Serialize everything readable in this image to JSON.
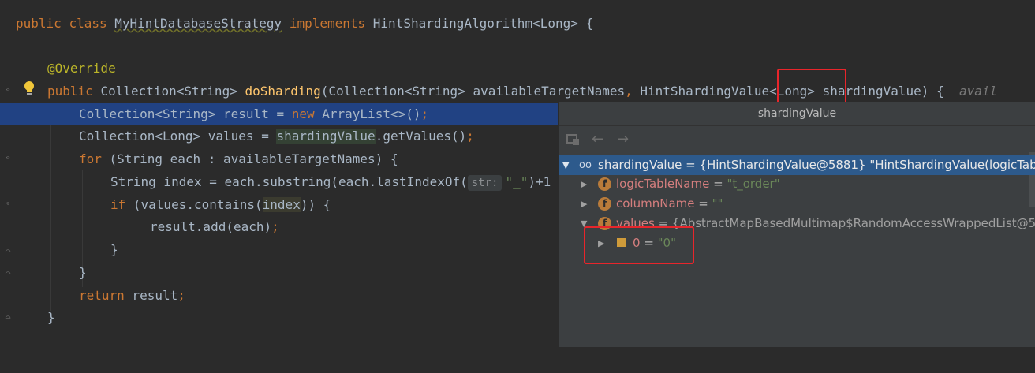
{
  "code": {
    "class_line": {
      "kw1": "public",
      "kw2": "class",
      "class_name": "MyHintDatabaseStrategy",
      "kw3": "implements",
      "rest": "HintShardingAlgorithm<Long> {"
    },
    "override": "@Override",
    "method_line": {
      "kw": "public",
      "ret": "Collection<String>",
      "name": "doSharding",
      "params1": "(Collection<String> availableTargetNames",
      "comma": ",",
      "params2": " HintShardingValue<Long> shardingValue) {",
      "hint": "avail"
    },
    "line_result": {
      "a": "Collection<String> result = ",
      "new": "new",
      "b": " ArrayList<>()",
      "semi": ";"
    },
    "line_values": {
      "a": "Collection<Long> values = ",
      "var": "shardingValue",
      "b": ".getValues()",
      "semi": ";"
    },
    "line_for": {
      "kw": "for",
      "rest": " (String each : availableTargetNames) {"
    },
    "line_index": {
      "a": "String index = each.substring(each.lastIndexOf(",
      "param_hint": "str:",
      "str": "\"_\"",
      "b": ")+1"
    },
    "line_if": {
      "kw": "if",
      "a": " (values.contains(",
      "var": "index",
      "b": ")) {"
    },
    "line_add": {
      "a": "result.add(each)",
      "semi": ";"
    },
    "brace_inner": "}",
    "brace_for": "}",
    "line_return": {
      "kw": "return",
      "a": " result",
      "semi": ";"
    },
    "brace_method": "}"
  },
  "debug_popup": {
    "title": "shardingValue",
    "toolbar_icons": [
      "frames-icon",
      "back-arrow-icon",
      "forward-arrow-icon"
    ],
    "tree": [
      {
        "name": "shardingValue",
        "value": " = {HintShardingValue@5881} \"HintShardingValue(logicTab... V",
        "expanded": true,
        "selected": true
      },
      {
        "name": "logicTableName",
        "eq": " = ",
        "value": "\"t_order\""
      },
      {
        "name": "columnName",
        "eq": " = ",
        "value": "\"\""
      },
      {
        "name": "values",
        "eq": " = ",
        "value": "{AbstractMapBasedMultimap$RandomAccessWrappedList@5..."
      },
      {
        "name": "0",
        "eq": " = ",
        "value": "\"0\""
      }
    ]
  },
  "colors": {
    "editor_bg": "#2b2b2b",
    "selection": "#214283",
    "keyword": "#cc7832",
    "annotation": "#bbb529",
    "method": "#ffc66d",
    "string": "#6a8759",
    "highlight_box": "#e8252b"
  }
}
